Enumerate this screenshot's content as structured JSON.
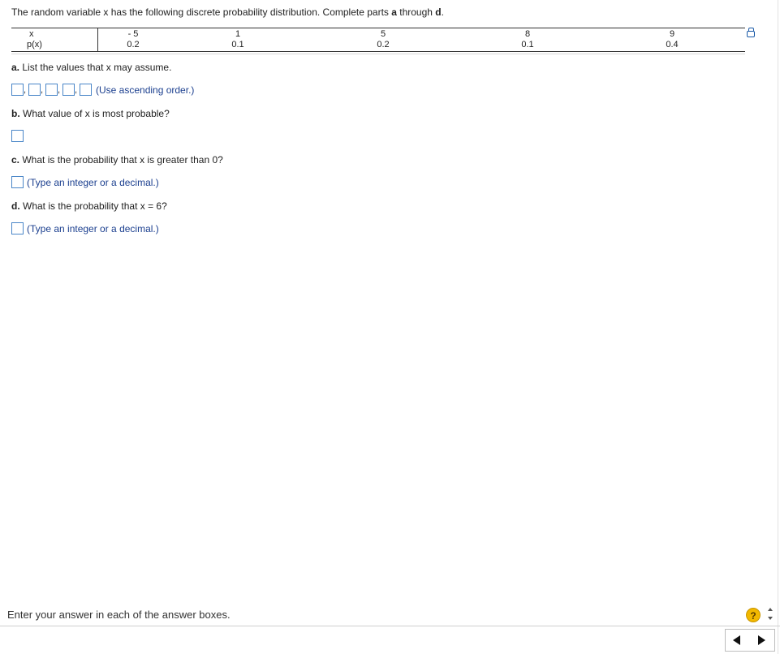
{
  "question": {
    "intro_start": "The random variable x has the following discrete probability distribution. Complete parts ",
    "intro_a": "a",
    "intro_mid": " through ",
    "intro_d": "d",
    "intro_end": "."
  },
  "table": {
    "x_header": "x",
    "p_header": "p(x)",
    "columns": [
      {
        "x": "- 5",
        "p": "0.2"
      },
      {
        "x": "1",
        "p": "0.1"
      },
      {
        "x": "5",
        "p": "0.2"
      },
      {
        "x": "8",
        "p": "0.1"
      },
      {
        "x": "9",
        "p": "0.4"
      }
    ]
  },
  "parts": {
    "a": {
      "letter": "a.",
      "text": " List the values that x may assume.",
      "comma": ",",
      "hint": "(Use ascending order.)"
    },
    "b": {
      "letter": "b.",
      "text": " What value of x is most probable?"
    },
    "c": {
      "letter": "c.",
      "text": " What is the probability that x is greater than 0?",
      "hint": "(Type an integer or a decimal.)"
    },
    "d": {
      "letter": "d.",
      "text": " What is the probability that x = 6?",
      "hint": "(Type an integer or a decimal.)"
    }
  },
  "footer": {
    "instruction": "Enter your answer in each of the answer boxes.",
    "help_label": "?"
  },
  "icons": {
    "copy": "clipboard-icon",
    "help": "help-icon",
    "prev": "arrow-left-icon",
    "next": "arrow-right-icon"
  },
  "colors": {
    "accent": "#4a86c8",
    "hint_text": "#1b3f8f",
    "help": "#f2b800"
  }
}
